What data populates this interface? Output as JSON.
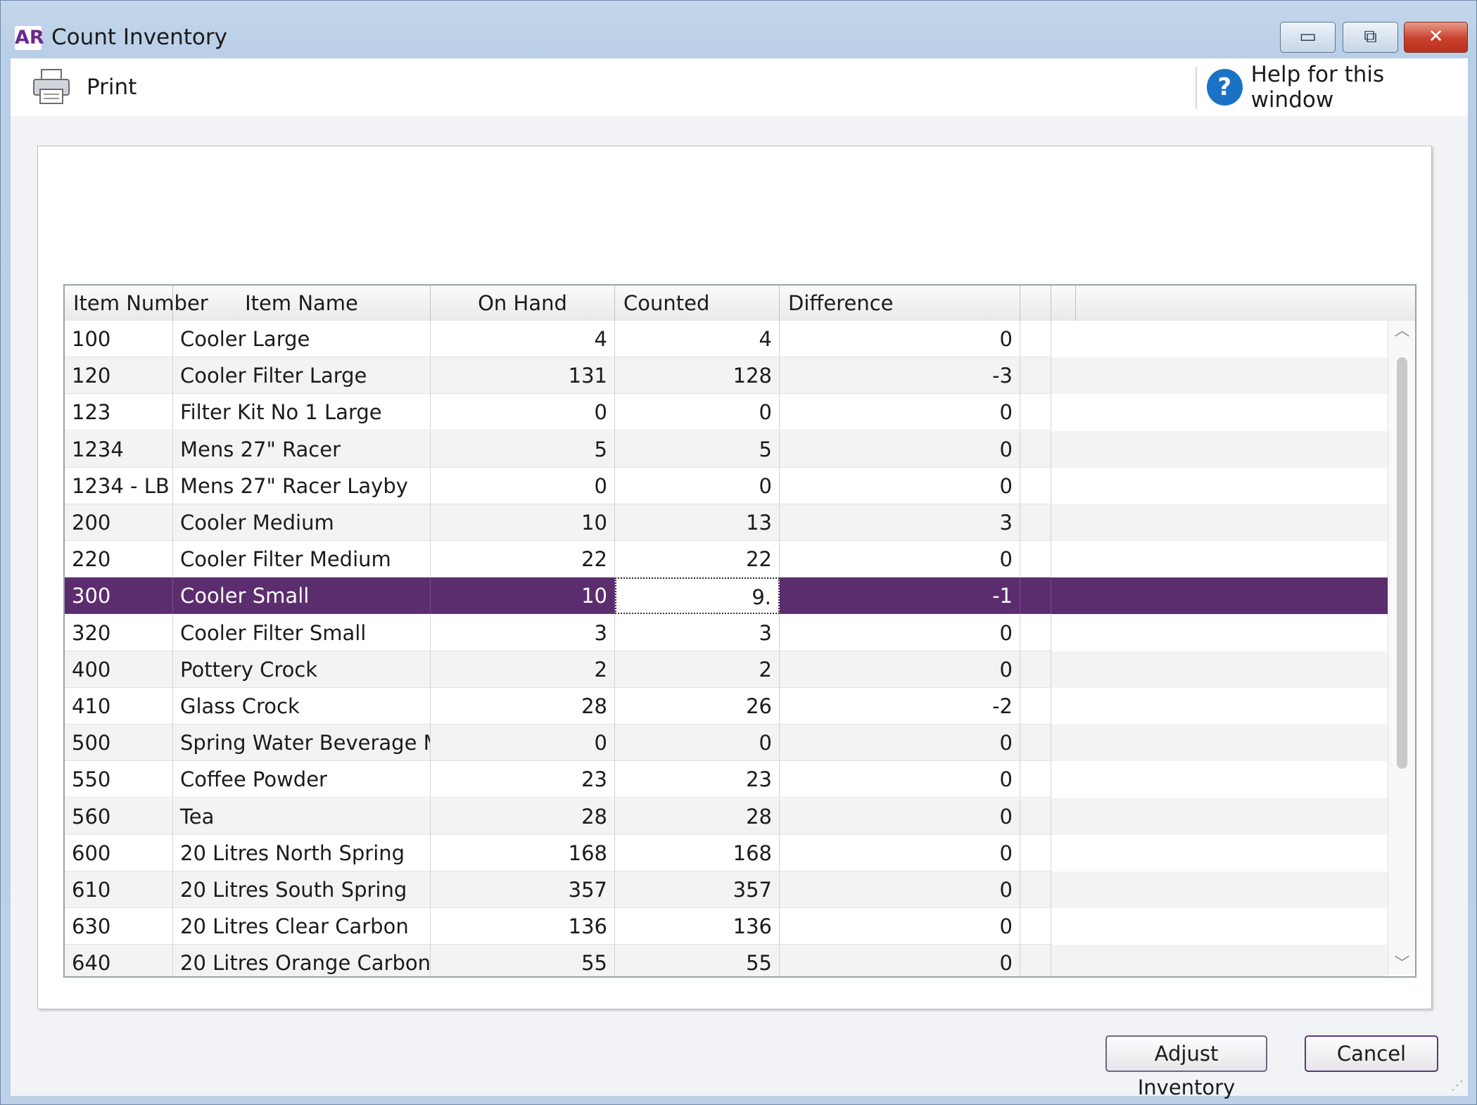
{
  "window": {
    "app_badge": "AR",
    "title": "Count Inventory",
    "min_glyph": "▭",
    "max_glyph": "⧉",
    "close_glyph": "✕"
  },
  "toolbar": {
    "print_label": "Print",
    "help_glyph": "?",
    "help_label": "Help for this window"
  },
  "table": {
    "columns": [
      "Item Number",
      "Item Name",
      "On Hand",
      "Counted",
      "Difference"
    ],
    "rows": [
      [
        "100",
        "Cooler Large",
        "4",
        "4",
        "0"
      ],
      [
        "120",
        "Cooler Filter Large",
        "131",
        "128",
        "-3"
      ],
      [
        "123",
        "Filter Kit No 1 Large",
        "0",
        "0",
        "0"
      ],
      [
        "1234",
        "Mens 27\" Racer",
        "5",
        "5",
        "0"
      ],
      [
        "1234 - LB",
        "Mens 27\" Racer Layby",
        "0",
        "0",
        "0"
      ],
      [
        "200",
        "Cooler Medium",
        "10",
        "13",
        "3"
      ],
      [
        "220",
        "Cooler Filter Medium",
        "22",
        "22",
        "0"
      ],
      [
        "300",
        "Cooler Small",
        "10",
        "9.",
        "-1"
      ],
      [
        "320",
        "Cooler Filter Small",
        "3",
        "3",
        "0"
      ],
      [
        "400",
        "Pottery Crock",
        "2",
        "2",
        "0"
      ],
      [
        "410",
        "Glass Crock",
        "28",
        "26",
        "-2"
      ],
      [
        "500",
        "Spring Water Beverage Maker",
        "0",
        "0",
        "0"
      ],
      [
        "550",
        "Coffee Powder",
        "23",
        "23",
        "0"
      ],
      [
        "560",
        "Tea",
        "28",
        "28",
        "0"
      ],
      [
        "600",
        "20 Litres North Spring",
        "168",
        "168",
        "0"
      ],
      [
        "610",
        "20 Litres South Spring",
        "357",
        "357",
        "0"
      ],
      [
        "630",
        "20 Litres Clear Carbon",
        "136",
        "136",
        "0"
      ],
      [
        "640",
        "20 Litres Orange Carbon",
        "55",
        "55",
        "0"
      ]
    ],
    "selected_row": 7
  },
  "buttons": {
    "adjust": "Adjust Inventory",
    "cancel": "Cancel"
  },
  "colors": {
    "selection": "#5c2d6e",
    "brand": "#6b2a8a"
  }
}
